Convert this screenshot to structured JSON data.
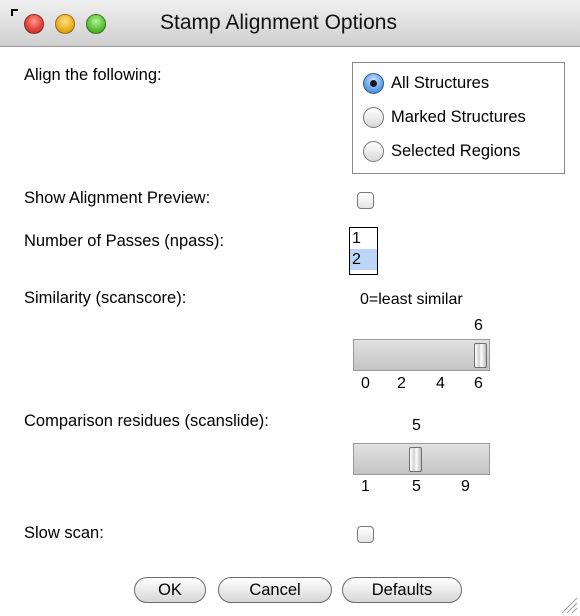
{
  "window": {
    "title": "Stamp Alignment Options"
  },
  "align": {
    "label": "Align the following:",
    "options": [
      "All Structures",
      "Marked Structures",
      "Selected Regions"
    ],
    "selected": "All Structures"
  },
  "preview": {
    "label": "Show Alignment Preview:",
    "checked": false
  },
  "npass": {
    "label": "Number of Passes (npass):",
    "options": [
      "1",
      "2"
    ],
    "selected": "2"
  },
  "scanscore": {
    "label": "Similarity (scanscore):",
    "caption": "0=least similar",
    "value": "6",
    "ticks": [
      "0",
      "2",
      "4",
      "6"
    ],
    "min": 0,
    "max": 6
  },
  "scanslide": {
    "label": "Comparison residues (scanslide):",
    "value": "5",
    "ticks": [
      "1",
      "5",
      "9"
    ],
    "min": 1,
    "max": 9
  },
  "slowscan": {
    "label": "Slow scan:",
    "checked": false
  },
  "buttons": {
    "ok": "OK",
    "cancel": "Cancel",
    "defaults": "Defaults"
  },
  "colors": {
    "selection": "#bcd6f7",
    "radio_accent": "#2f6fc0"
  }
}
